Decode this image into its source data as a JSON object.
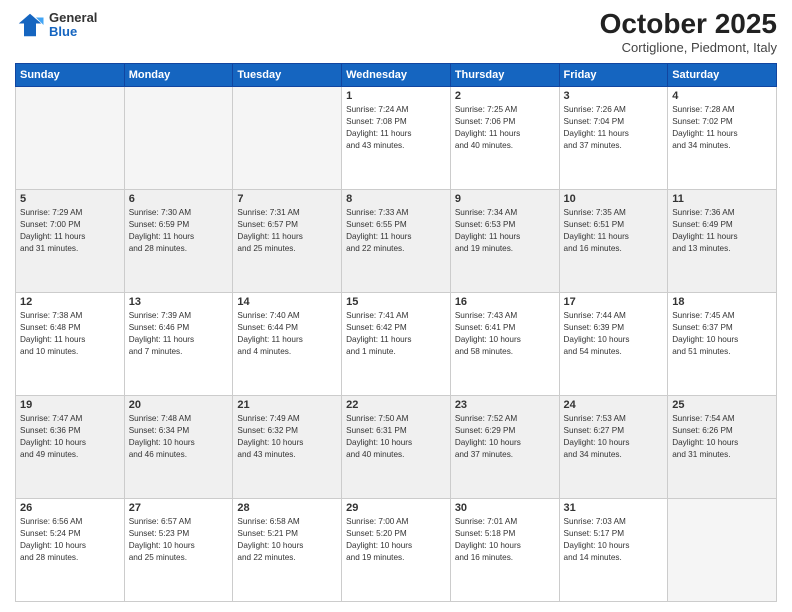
{
  "header": {
    "logo": {
      "general": "General",
      "blue": "Blue"
    },
    "title": "October 2025",
    "location": "Cortiglione, Piedmont, Italy"
  },
  "weekdays": [
    "Sunday",
    "Monday",
    "Tuesday",
    "Wednesday",
    "Thursday",
    "Friday",
    "Saturday"
  ],
  "weeks": [
    [
      {
        "day": "",
        "info": "",
        "empty": true
      },
      {
        "day": "",
        "info": "",
        "empty": true
      },
      {
        "day": "",
        "info": "",
        "empty": true
      },
      {
        "day": "1",
        "info": "Sunrise: 7:24 AM\nSunset: 7:08 PM\nDaylight: 11 hours\nand 43 minutes."
      },
      {
        "day": "2",
        "info": "Sunrise: 7:25 AM\nSunset: 7:06 PM\nDaylight: 11 hours\nand 40 minutes."
      },
      {
        "day": "3",
        "info": "Sunrise: 7:26 AM\nSunset: 7:04 PM\nDaylight: 11 hours\nand 37 minutes."
      },
      {
        "day": "4",
        "info": "Sunrise: 7:28 AM\nSunset: 7:02 PM\nDaylight: 11 hours\nand 34 minutes."
      }
    ],
    [
      {
        "day": "5",
        "info": "Sunrise: 7:29 AM\nSunset: 7:00 PM\nDaylight: 11 hours\nand 31 minutes."
      },
      {
        "day": "6",
        "info": "Sunrise: 7:30 AM\nSunset: 6:59 PM\nDaylight: 11 hours\nand 28 minutes."
      },
      {
        "day": "7",
        "info": "Sunrise: 7:31 AM\nSunset: 6:57 PM\nDaylight: 11 hours\nand 25 minutes."
      },
      {
        "day": "8",
        "info": "Sunrise: 7:33 AM\nSunset: 6:55 PM\nDaylight: 11 hours\nand 22 minutes."
      },
      {
        "day": "9",
        "info": "Sunrise: 7:34 AM\nSunset: 6:53 PM\nDaylight: 11 hours\nand 19 minutes."
      },
      {
        "day": "10",
        "info": "Sunrise: 7:35 AM\nSunset: 6:51 PM\nDaylight: 11 hours\nand 16 minutes."
      },
      {
        "day": "11",
        "info": "Sunrise: 7:36 AM\nSunset: 6:49 PM\nDaylight: 11 hours\nand 13 minutes."
      }
    ],
    [
      {
        "day": "12",
        "info": "Sunrise: 7:38 AM\nSunset: 6:48 PM\nDaylight: 11 hours\nand 10 minutes."
      },
      {
        "day": "13",
        "info": "Sunrise: 7:39 AM\nSunset: 6:46 PM\nDaylight: 11 hours\nand 7 minutes."
      },
      {
        "day": "14",
        "info": "Sunrise: 7:40 AM\nSunset: 6:44 PM\nDaylight: 11 hours\nand 4 minutes."
      },
      {
        "day": "15",
        "info": "Sunrise: 7:41 AM\nSunset: 6:42 PM\nDaylight: 11 hours\nand 1 minute."
      },
      {
        "day": "16",
        "info": "Sunrise: 7:43 AM\nSunset: 6:41 PM\nDaylight: 10 hours\nand 58 minutes."
      },
      {
        "day": "17",
        "info": "Sunrise: 7:44 AM\nSunset: 6:39 PM\nDaylight: 10 hours\nand 54 minutes."
      },
      {
        "day": "18",
        "info": "Sunrise: 7:45 AM\nSunset: 6:37 PM\nDaylight: 10 hours\nand 51 minutes."
      }
    ],
    [
      {
        "day": "19",
        "info": "Sunrise: 7:47 AM\nSunset: 6:36 PM\nDaylight: 10 hours\nand 49 minutes."
      },
      {
        "day": "20",
        "info": "Sunrise: 7:48 AM\nSunset: 6:34 PM\nDaylight: 10 hours\nand 46 minutes."
      },
      {
        "day": "21",
        "info": "Sunrise: 7:49 AM\nSunset: 6:32 PM\nDaylight: 10 hours\nand 43 minutes."
      },
      {
        "day": "22",
        "info": "Sunrise: 7:50 AM\nSunset: 6:31 PM\nDaylight: 10 hours\nand 40 minutes."
      },
      {
        "day": "23",
        "info": "Sunrise: 7:52 AM\nSunset: 6:29 PM\nDaylight: 10 hours\nand 37 minutes."
      },
      {
        "day": "24",
        "info": "Sunrise: 7:53 AM\nSunset: 6:27 PM\nDaylight: 10 hours\nand 34 minutes."
      },
      {
        "day": "25",
        "info": "Sunrise: 7:54 AM\nSunset: 6:26 PM\nDaylight: 10 hours\nand 31 minutes."
      }
    ],
    [
      {
        "day": "26",
        "info": "Sunrise: 6:56 AM\nSunset: 5:24 PM\nDaylight: 10 hours\nand 28 minutes."
      },
      {
        "day": "27",
        "info": "Sunrise: 6:57 AM\nSunset: 5:23 PM\nDaylight: 10 hours\nand 25 minutes."
      },
      {
        "day": "28",
        "info": "Sunrise: 6:58 AM\nSunset: 5:21 PM\nDaylight: 10 hours\nand 22 minutes."
      },
      {
        "day": "29",
        "info": "Sunrise: 7:00 AM\nSunset: 5:20 PM\nDaylight: 10 hours\nand 19 minutes."
      },
      {
        "day": "30",
        "info": "Sunrise: 7:01 AM\nSunset: 5:18 PM\nDaylight: 10 hours\nand 16 minutes."
      },
      {
        "day": "31",
        "info": "Sunrise: 7:03 AM\nSunset: 5:17 PM\nDaylight: 10 hours\nand 14 minutes."
      },
      {
        "day": "",
        "info": "",
        "empty": true
      }
    ]
  ]
}
